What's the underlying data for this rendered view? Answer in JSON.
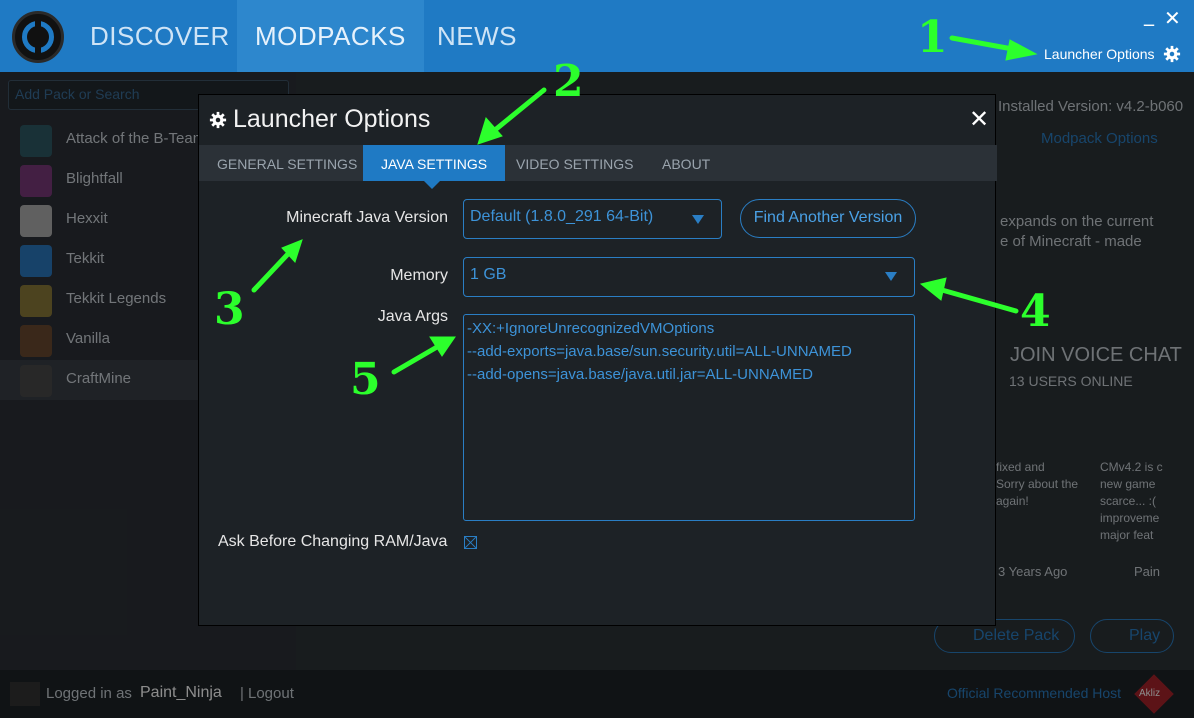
{
  "window": {
    "nav_tabs": [
      "DISCOVER",
      "MODPACKS",
      "NEWS"
    ],
    "active_tab": "MODPACKS",
    "minimize": "_",
    "close": "✕",
    "launcher_options_label": "Launcher Options"
  },
  "sidebar": {
    "search_placeholder": "Add Pack or Search",
    "packs": [
      {
        "label": "Attack of the B-Team",
        "color": "#2f5a64"
      },
      {
        "label": "Blightfall",
        "color": "#7a3a7a"
      },
      {
        "label": "Hexxit",
        "color": "#b0b0b0"
      },
      {
        "label": "Tekkit",
        "color": "#2a78c0"
      },
      {
        "label": "Tekkit Legends",
        "color": "#8a7a3a"
      },
      {
        "label": "Vanilla",
        "color": "#6b4a30"
      },
      {
        "label": "CraftMine",
        "color": "#4a4a4a"
      }
    ]
  },
  "main": {
    "installed_version": "Installed Version: v4.2-b060",
    "modpack_options": "Modpack Options",
    "description_line1": "expands on the current",
    "description_line2": "e of Minecraft - made",
    "voice_chat_title": "JOIN VOICE CHAT",
    "voice_chat_users": "13 USERS ONLINE",
    "news_card1": "fixed and\nSorry about the\nagain!",
    "news_card2": "CMv4.2 is c\nnew game\nscarce... :(\nimproveme\nmajor feat",
    "news_time": "3 Years Ago",
    "news_author": "Pain",
    "delete_label": "Delete Pack",
    "play_label": "Play"
  },
  "footer": {
    "logged_in_prefix": "Logged in as",
    "username": "Paint_Ninja",
    "separator": "|",
    "logout": "Logout",
    "host_label": "Official Recommended Host",
    "host_brand": "Akliz"
  },
  "dialog": {
    "title": "Launcher Options",
    "close_label": "✕",
    "tabs": [
      "GENERAL SETTINGS",
      "JAVA SETTINGS",
      "VIDEO SETTINGS",
      "ABOUT"
    ],
    "active_tab": "JAVA SETTINGS",
    "java_version_label": "Minecraft Java Version",
    "java_version_value": "Default (1.8.0_291 64-Bit)",
    "find_version_button": "Find Another Version",
    "memory_label": "Memory",
    "memory_value": "1 GB",
    "java_args_label": "Java Args",
    "java_args_value": "-XX:+IgnoreUnrecognizedVMOptions\n--add-exports=java.base/sun.security.util=ALL-UNNAMED\n--add-opens=java.base/java.util.jar=ALL-UNNAMED",
    "ask_label": "Ask Before Changing RAM/Java",
    "ask_checked": true
  },
  "annotations": [
    "1",
    "2",
    "3",
    "4",
    "5"
  ],
  "colors": {
    "accent": "#1f7ac4",
    "annotation": "#2cff2c",
    "dialog_bg": "#1d2226"
  }
}
